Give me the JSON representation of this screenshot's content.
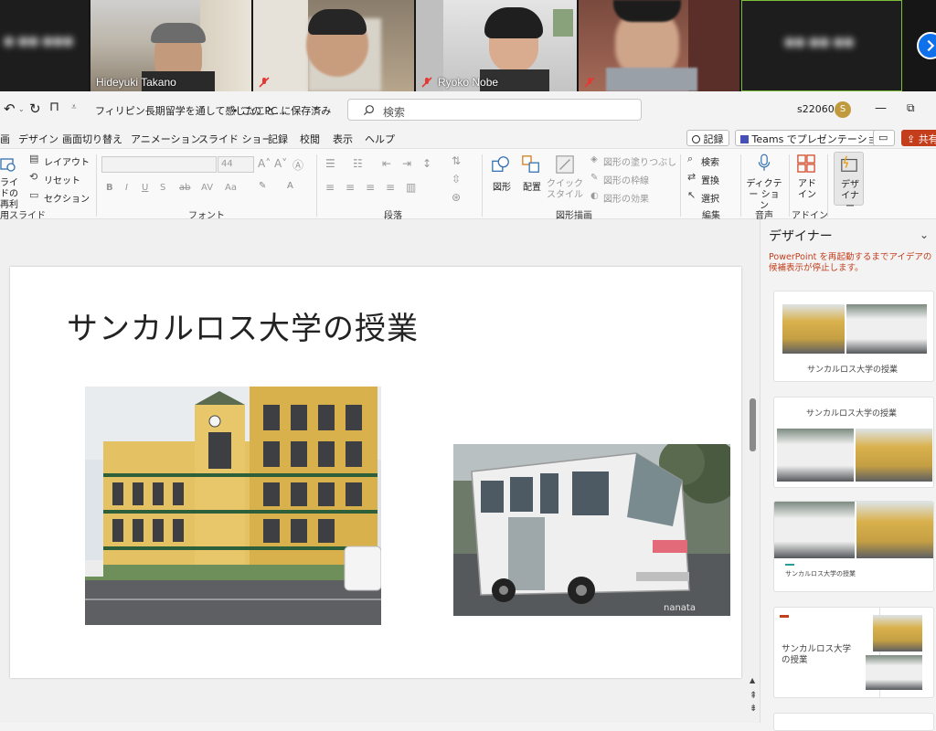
{
  "meeting": {
    "participants": [
      {
        "name": "Hideyuki Takano",
        "muted": false
      },
      {
        "name": "",
        "muted": true
      },
      {
        "name": "Ryoko Nobe",
        "muted": true
      },
      {
        "name": "",
        "muted": true
      }
    ]
  },
  "titlebar": {
    "doc_title": "フィリピン長期留学を通して感じたこと…",
    "save_status": "• この PC に保存済み",
    "search_placeholder": "検索",
    "user_id": "s22060",
    "avatar_initial": "S"
  },
  "tabs": [
    "画",
    "デザイン",
    "画面切り替え",
    "アニメーション",
    "スライド ショー",
    "記録",
    "校閲",
    "表示",
    "ヘルプ"
  ],
  "header_buttons": {
    "record": "記録",
    "teams": "Teams でプレゼンテーション",
    "share": "共有"
  },
  "ribbon": {
    "slides": {
      "reuse": "ライドの再利用",
      "layout": "レイアウト",
      "reset": "リセット",
      "section": "セクション",
      "label": "スライド"
    },
    "font": {
      "size": "44",
      "label": "フォント"
    },
    "paragraph": {
      "label": "段落"
    },
    "drawing": {
      "shapes": "図形",
      "arrange": "配置",
      "quick_styles": "クイック スタイル",
      "fill": "図形の塗りつぶし",
      "outline": "図形の枠線",
      "effects": "図形の効果",
      "label": "図形描画"
    },
    "editing": {
      "find": "検索",
      "replace": "置換",
      "select": "選択",
      "label": "編集"
    },
    "voice": {
      "dictate": "ディクテー ション",
      "label": "音声"
    },
    "addins": {
      "addins": "アド イン",
      "label": "アドイン"
    },
    "designer": {
      "label": "デザ イナー"
    }
  },
  "slide": {
    "title": "サンカルロス大学の授業",
    "watermark": "nanata"
  },
  "designer": {
    "title": "デザイナー",
    "warning": "PowerPoint を再起動するまでアイデアの候補表示が停止します。",
    "caption": "サンカルロス大学の授業"
  },
  "colors": {
    "accent": "#c43e1c",
    "share_button": "#c43e1c",
    "avatar": "#c19a3e"
  }
}
